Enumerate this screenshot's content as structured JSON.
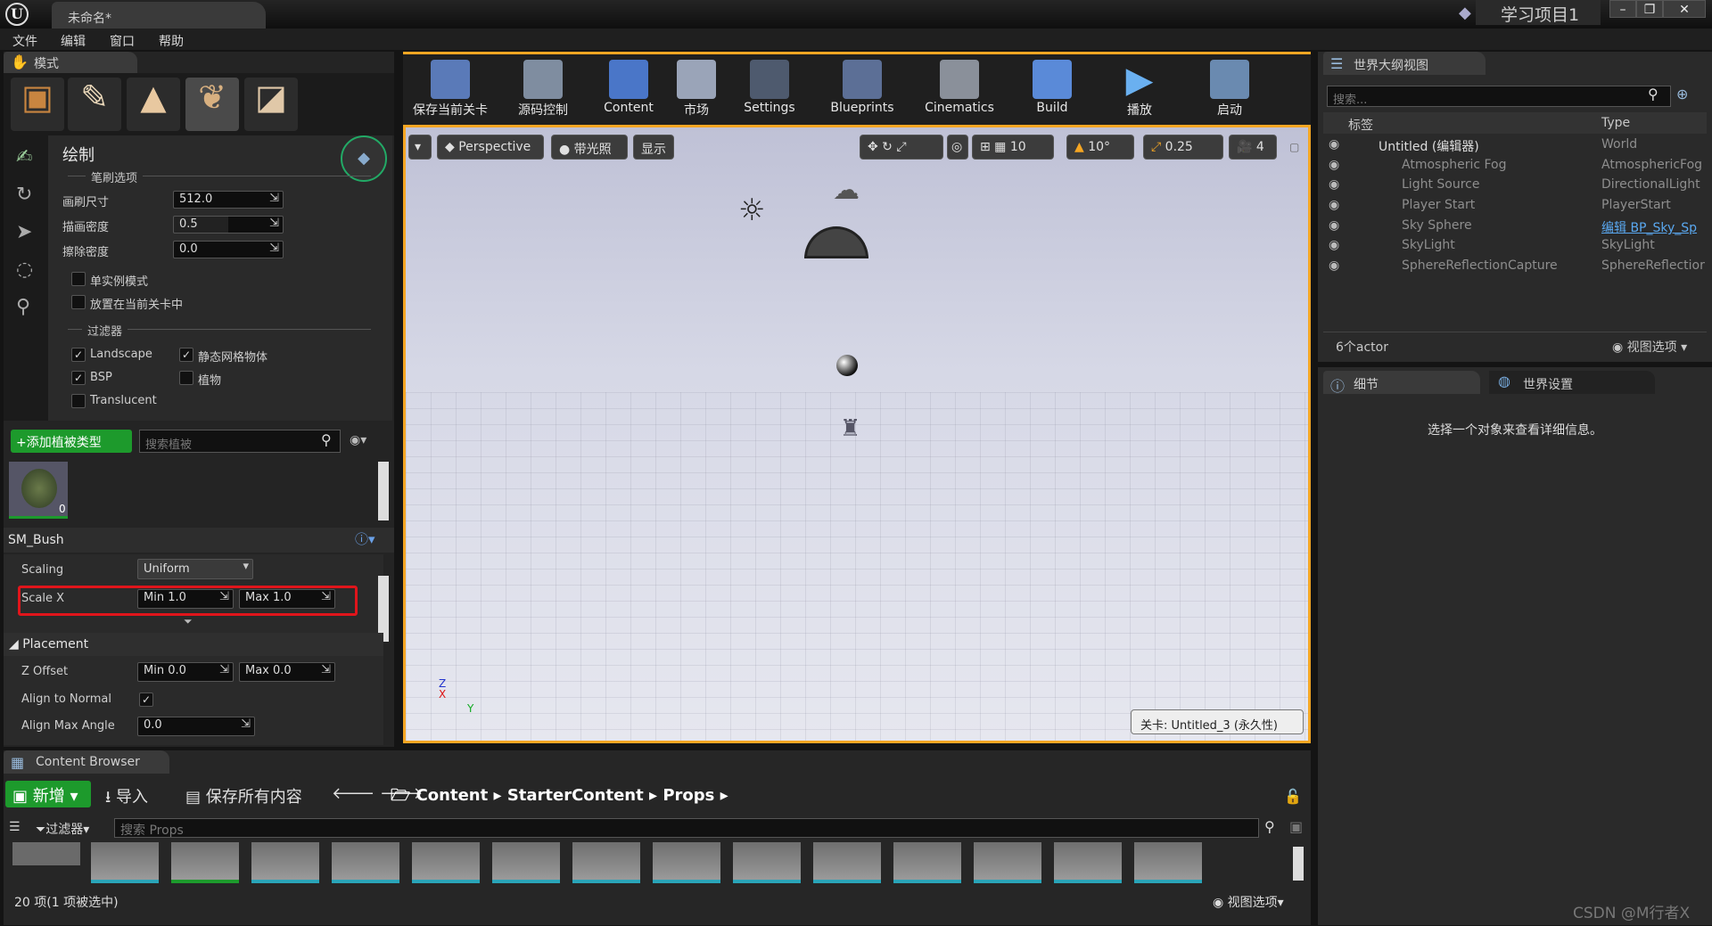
{
  "app": {
    "doc_tab": "未命名*",
    "project_name": "学习项目1",
    "menu": [
      "文件",
      "编辑",
      "窗口",
      "帮助"
    ]
  },
  "modes": {
    "tab": "模式",
    "section_title": "绘制",
    "brush_options_title": "笔刷选项",
    "brush_size_label": "画刷尺寸",
    "brush_size_value": "512.0",
    "paint_density_label": "描画密度",
    "paint_density_value": "0.5",
    "erase_density_label": "擦除密度",
    "erase_density_value": "0.0",
    "single_instance_label": "单实例模式",
    "place_in_level_label": "放置在当前关卡中",
    "filters_title": "过滤器",
    "filters": [
      {
        "label": "Landscape",
        "checked": true
      },
      {
        "label": "静态网格物体",
        "checked": true
      },
      {
        "label": "BSP",
        "checked": true
      },
      {
        "label": "植物",
        "checked": false
      },
      {
        "label": "Translucent",
        "checked": false
      }
    ],
    "add_foliage_label": "+添加植被类型",
    "search_foliage_placeholder": "搜索植被",
    "foliage_count": "0",
    "foliage_name": "SM_Bush",
    "scaling_label": "Scaling",
    "scaling_value": "Uniform",
    "scale_x_label": "Scale X",
    "scale_x_min": "Min  1.0",
    "scale_x_max": "Max  1.0",
    "placement_title": "Placement",
    "z_offset_label": "Z Offset",
    "z_offset_min": "Min  0.0",
    "z_offset_max": "Max  0.0",
    "align_normal_label": "Align to Normal",
    "align_max_angle_label": "Align Max Angle",
    "align_max_angle_value": "0.0"
  },
  "toolbar": [
    "保存当前关卡",
    "源码控制",
    "Content",
    "市场",
    "Settings",
    "Blueprints",
    "Cinematics",
    "Build",
    "播放",
    "启动"
  ],
  "viewport": {
    "perspective": "Perspective",
    "lit": "带光照",
    "show": "显示",
    "grid_snap": "10",
    "rot_snap": "10°",
    "scale_snap": "0.25",
    "cam_speed": "4",
    "level_label": "关卡: Untitled_3 (永久性)"
  },
  "outliner": {
    "tab": "世界大纲视图",
    "search_placeholder": "搜索...",
    "col_label": "标签",
    "col_type": "Type",
    "rows": [
      {
        "name": "Untitled (编辑器)",
        "type": "World"
      },
      {
        "name": "Atmospheric Fog",
        "type": "AtmosphericFog"
      },
      {
        "name": "Light Source",
        "type": "DirectionalLight"
      },
      {
        "name": "Player Start",
        "type": "PlayerStart"
      },
      {
        "name": "Sky Sphere",
        "type": "编辑 BP_Sky_Sp"
      },
      {
        "name": "SkyLight",
        "type": "SkyLight"
      },
      {
        "name": "SphereReflectionCapture",
        "type": "SphereReflectior"
      }
    ],
    "actor_count": "6个actor",
    "view_options": "视图选项"
  },
  "details": {
    "tab": "细节",
    "world_settings_tab": "世界设置",
    "empty_message": "选择一个对象来查看详细信息。"
  },
  "content_browser": {
    "tab": "Content Browser",
    "new_label": "新增",
    "import_label": "导入",
    "save_all_label": "保存所有内容",
    "path": [
      "Content",
      "StarterContent",
      "Props"
    ],
    "filters_label": "过滤器",
    "search_placeholder": "搜索 Props",
    "status": "20 项(1 项被选中)",
    "view_options": "视图选项"
  },
  "watermark": "CSDN @M行者X",
  "colors": {
    "accent": "#f5a623",
    "highlight_box": "#e0151b",
    "selection_green": "#1d9a2c"
  }
}
